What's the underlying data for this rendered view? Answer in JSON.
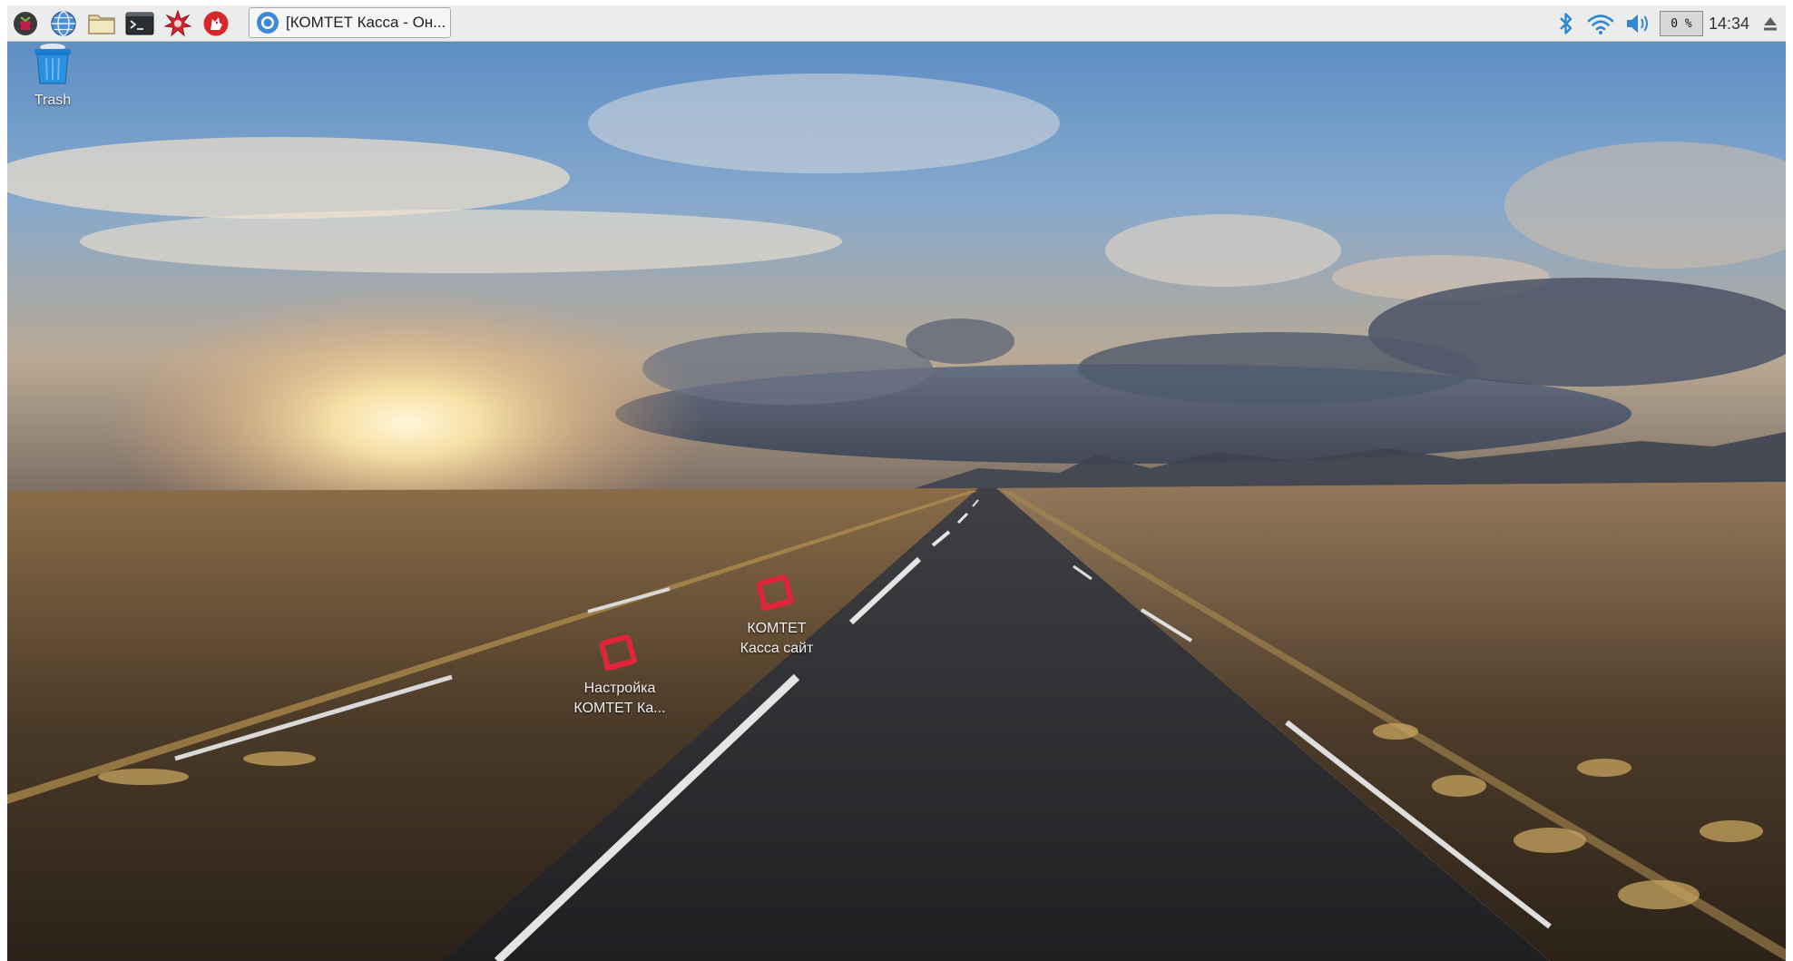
{
  "taskbar": {
    "launchers": [
      {
        "name": "raspberry-menu",
        "icon": "raspberry-pi-icon"
      },
      {
        "name": "web-browser",
        "icon": "globe-icon"
      },
      {
        "name": "file-manager",
        "icon": "folder-icon"
      },
      {
        "name": "terminal",
        "icon": "terminal-icon"
      },
      {
        "name": "mathematica",
        "icon": "red-star-icon"
      },
      {
        "name": "wolfram",
        "icon": "wolf-icon"
      }
    ],
    "active_window": {
      "title": "[КОМТЕТ Касса - Он...",
      "icon": "chromium-icon"
    },
    "tray": {
      "bluetooth_icon": "bluetooth-icon",
      "wifi_icon": "wifi-icon",
      "volume_icon": "volume-icon",
      "cpu_usage": "0 %",
      "clock": "14:34",
      "eject_icon": "eject-icon"
    }
  },
  "desktop": {
    "icons": [
      {
        "label_line1": "Trash",
        "label_line2": "",
        "icon": "trash-icon"
      },
      {
        "label_line1": "КОМТЕТ",
        "label_line2": "Касса сайт",
        "icon": "komtet-logo-icon"
      },
      {
        "label_line1": "Настройка",
        "label_line2": "КОМТЕТ Ка...",
        "icon": "komtet-logo-icon"
      }
    ]
  },
  "colors": {
    "taskbar_bg": "#ececec",
    "komtet_red": "#e0243a",
    "accent_blue": "#2f87d6",
    "sky_top": "#5a8cc0",
    "road": "#2a2a2c"
  }
}
